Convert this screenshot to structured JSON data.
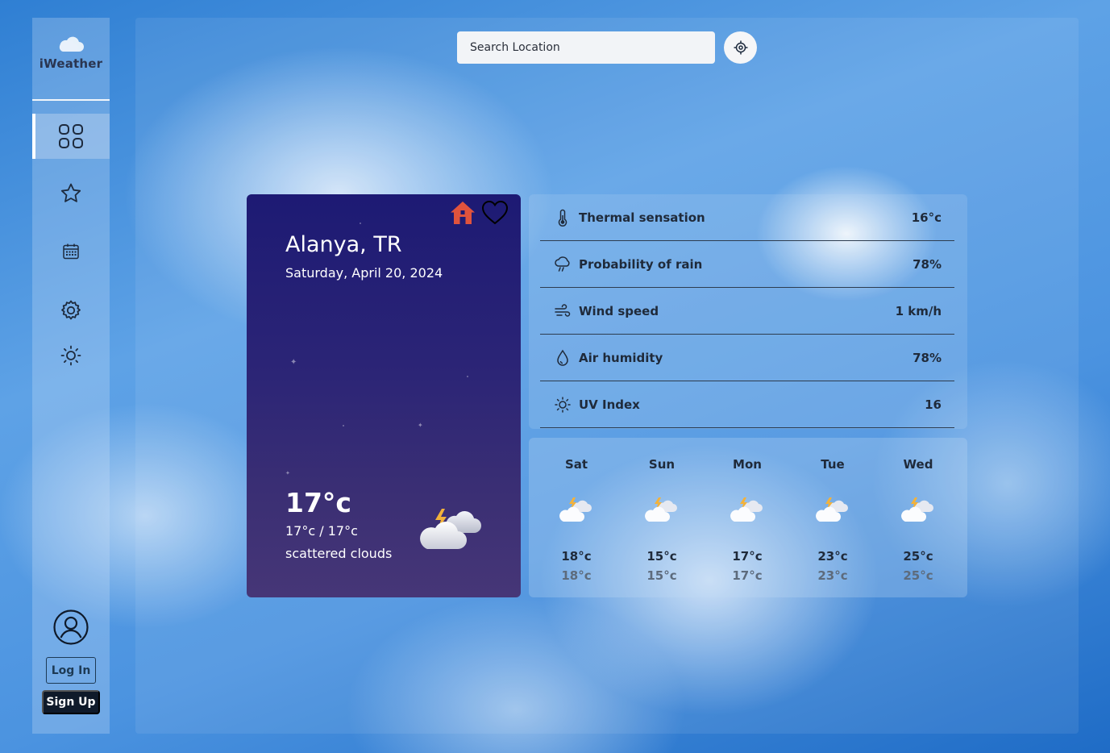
{
  "app": {
    "name": "iWeather"
  },
  "sidebar": {
    "items": [
      {
        "name": "dashboard",
        "icon": "grid-icon",
        "active": true
      },
      {
        "name": "favorites",
        "icon": "star-icon",
        "active": false
      },
      {
        "name": "calendar",
        "icon": "calendar-icon",
        "active": false
      },
      {
        "name": "settings",
        "icon": "gear-icon",
        "active": false
      },
      {
        "name": "theme",
        "icon": "sun-icon",
        "active": false
      }
    ],
    "login_label": "Log In",
    "signup_label": "Sign Up"
  },
  "search": {
    "placeholder": "Search Location"
  },
  "current": {
    "city": "Alanya, TR",
    "date": "Saturday, April 20, 2024",
    "temp": "17°c",
    "range": "17°c / 17°c",
    "description": "scattered clouds"
  },
  "details": [
    {
      "label": "Thermal sensation",
      "value": "16°c",
      "icon": "thermometer-icon"
    },
    {
      "label": "Probability of rain",
      "value": "78%",
      "icon": "rain-cloud-icon"
    },
    {
      "label": "Wind speed",
      "value": "1 km/h",
      "icon": "wind-icon"
    },
    {
      "label": "Air humidity",
      "value": "78%",
      "icon": "droplet-icon"
    },
    {
      "label": "UV Index",
      "value": "16",
      "icon": "sun-icon"
    }
  ],
  "forecast": [
    {
      "day": "Sat",
      "max": "18°c",
      "min": "18°c"
    },
    {
      "day": "Sun",
      "max": "15°c",
      "min": "15°c"
    },
    {
      "day": "Mon",
      "max": "17°c",
      "min": "17°c"
    },
    {
      "day": "Tue",
      "max": "23°c",
      "min": "23°c"
    },
    {
      "day": "Wed",
      "max": "25°c",
      "min": "25°c"
    }
  ],
  "colors": {
    "card_top": "#1d1a74",
    "card_bottom": "#463677",
    "home_icon": "#e0533d",
    "dark_button": "#0f1a2a"
  }
}
